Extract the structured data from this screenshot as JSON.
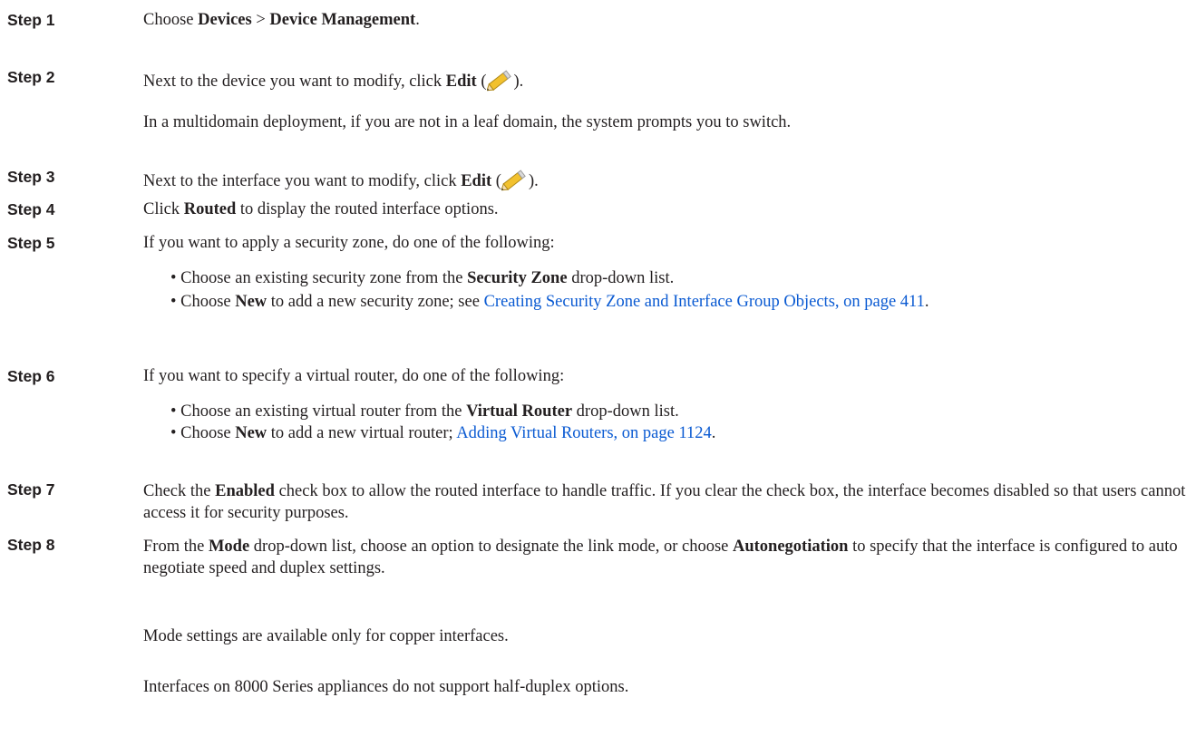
{
  "steps": [
    {
      "label": "Step 1",
      "pre": "Choose ",
      "b1": "Devices",
      "mid": " > ",
      "b2": "Device Management",
      "post": "."
    },
    {
      "label": "Step 2",
      "pre": "Next to the device you want to modify, click ",
      "bold": "Edit",
      "open": " (",
      "close": ").",
      "note": "In a multidomain deployment, if you are not in a leaf domain, the system prompts you to switch."
    },
    {
      "label": "Step 3",
      "pre": "Next to the interface you want to modify, click ",
      "bold": "Edit",
      "open": " (",
      "close": ")."
    },
    {
      "label": "Step 4",
      "pre": "Click ",
      "bold": "Routed",
      "post": " to display the routed interface options."
    },
    {
      "label": "Step 5",
      "text": "If you want to apply a security zone, do one of the following:",
      "b1_pre": "Choose an existing security zone from the ",
      "b1_bold": "Security Zone",
      "b1_post": " drop-down list.",
      "b2_pre": "Choose ",
      "b2_bold": "New",
      "b2_post": " to add a new security zone; see ",
      "b2_link": "Creating Security Zone and Interface Group Objects, on page 411",
      "b2_end": "."
    },
    {
      "label": "Step 6",
      "text": "If you want to specify a virtual router, do one of the following:",
      "b1_pre": "Choose an existing virtual router from the ",
      "b1_bold": "Virtual Router",
      "b1_post": " drop-down list.",
      "b2_pre": "Choose ",
      "b2_bold": "New",
      "b2_post": " to add a new virtual router; ",
      "b2_link": "Adding Virtual Routers, on page 1124",
      "b2_end": "."
    },
    {
      "label": "Step 7",
      "pre": "Check the ",
      "bold": "Enabled",
      "post": " check box to allow the routed interface to handle traffic. If you clear the check box, the interface becomes disabled so that users cannot access it for security purposes."
    },
    {
      "label": "Step 8",
      "pre": "From the ",
      "b1": "Mode",
      "mid": " drop-down list, choose an option to designate the link mode, or choose ",
      "b2": "Autonegotiation",
      "post": " to specify that the interface is configured to auto negotiate speed and duplex settings.",
      "note1": "Mode settings are available only for copper interfaces.",
      "note2": "Interfaces on 8000 Series appliances do not support half-duplex options."
    }
  ],
  "bullet_char": "•",
  "edit_icon": "pencil-icon",
  "colors": {
    "text": "#231f20",
    "link": "#0a5ad2"
  }
}
